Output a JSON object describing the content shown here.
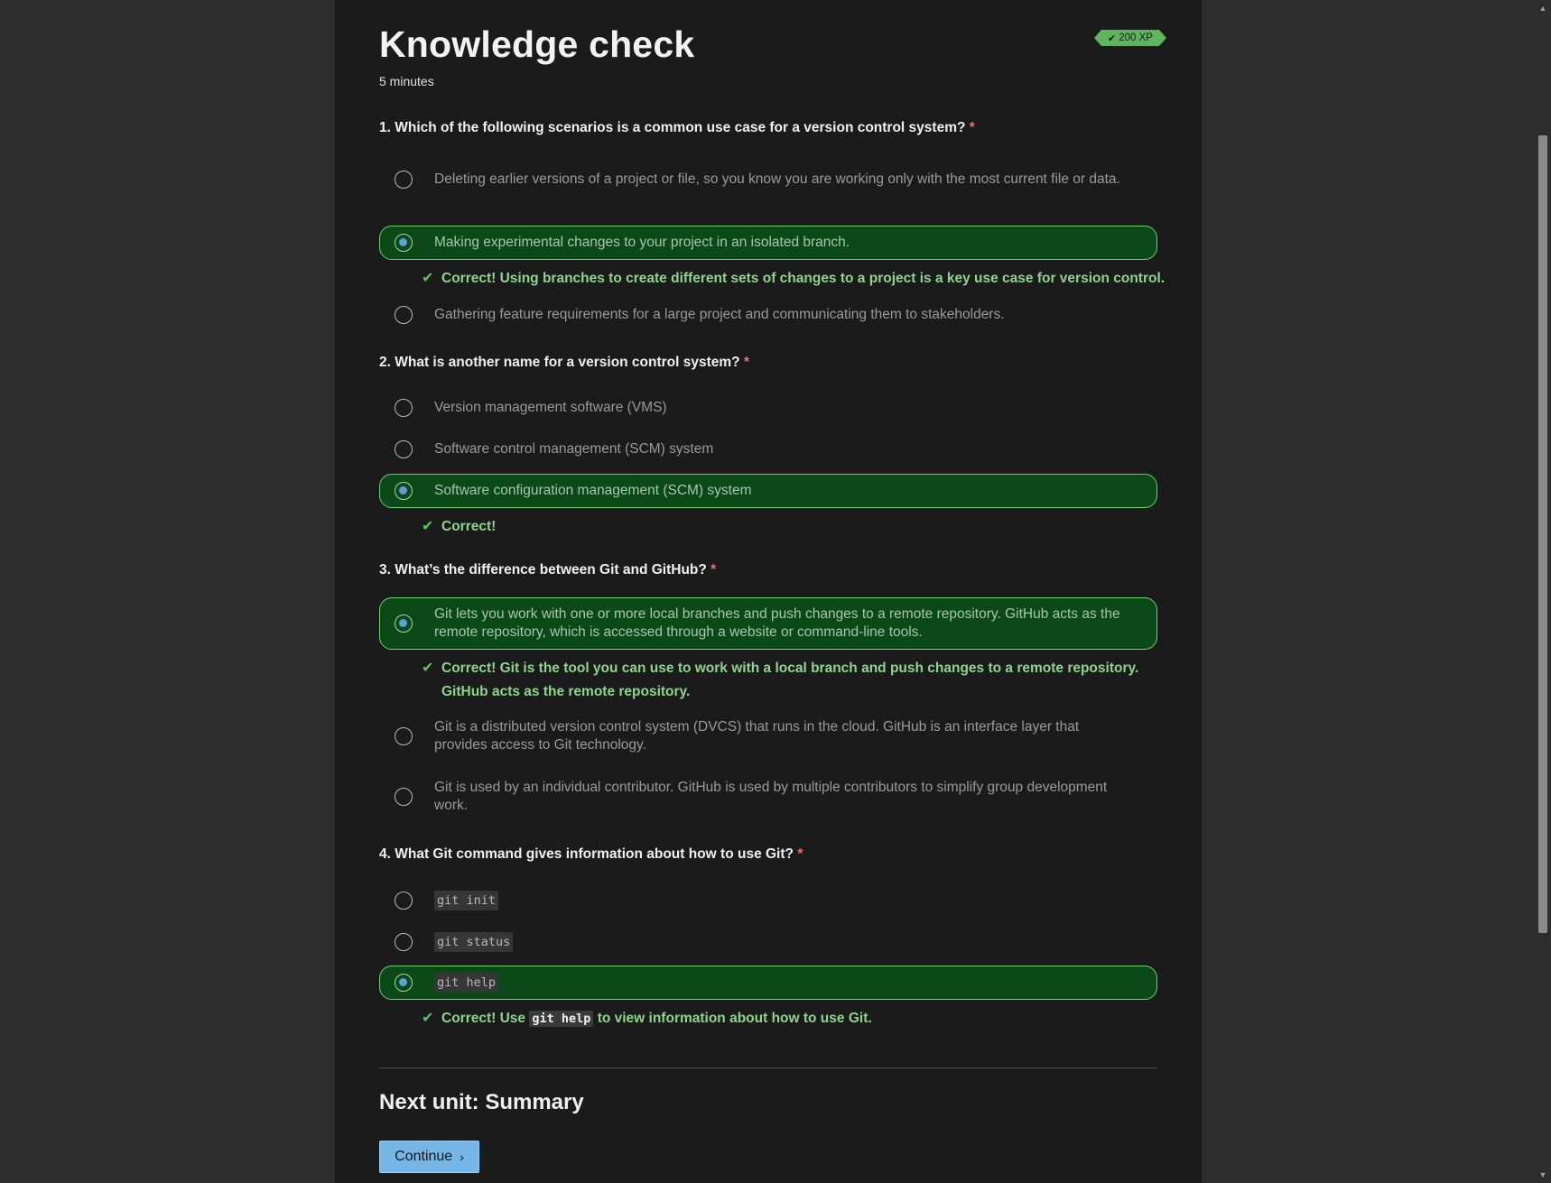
{
  "header": {
    "title": "Knowledge check",
    "duration": "5 minutes",
    "xp_badge": "200 XP"
  },
  "colors": {
    "selected_bg": "#0b4a18",
    "selected_border": "#6fcf6f",
    "correct_text": "#8ed48e",
    "continue_button": "#75b6e7"
  },
  "questions": [
    {
      "label": "1. Which of the following scenarios is a common use case for a version control system?",
      "required_mark": "*",
      "options": [
        "Deleting earlier versions of a project or file, so you know you are working only with the most current file or data.",
        "Making experimental changes to your project in an isolated branch.",
        "Gathering feature requirements for a large project and communicating them to stakeholders."
      ],
      "selected_index": 1,
      "feedback": "Correct! Using branches to create different sets of changes to a project is a key use case for version control."
    },
    {
      "label": "2. What is another name for a version control system?",
      "required_mark": "*",
      "options": [
        "Version management software (VMS)",
        "Software control management (SCM) system",
        "Software configuration management (SCM) system"
      ],
      "selected_index": 2,
      "feedback": "Correct!"
    },
    {
      "label": "3. What’s the difference between Git and GitHub?",
      "required_mark": "*",
      "options": [
        "Git lets you work with one or more local branches and push changes to a remote repository. GitHub acts as the remote repository, which is accessed through a website or command-line tools.",
        "Git is a distributed version control system (DVCS) that runs in the cloud. GitHub is an interface layer that provides access to Git technology.",
        "Git is used by an individual contributor. GitHub is used by multiple contributors to simplify group development work."
      ],
      "selected_index": 0,
      "feedback": "Correct! Git is the tool you can use to work with a local branch and push changes to a remote repository. GitHub acts as the remote repository."
    },
    {
      "label": "4. What Git command gives information about how to use Git?",
      "required_mark": "*",
      "options": [
        "git init",
        "git status",
        "git help"
      ],
      "selected_index": 2,
      "feedback_prefix": "Correct! Use",
      "feedback_code": "git help",
      "feedback_suffix": "to view information about how to use Git."
    }
  ],
  "next_unit": {
    "heading": "Next unit: Summary",
    "button_label": "Continue"
  },
  "icons": {
    "check": "✔",
    "chevron_right": "›",
    "scroll_up": "▲",
    "scroll_down": "▼"
  }
}
